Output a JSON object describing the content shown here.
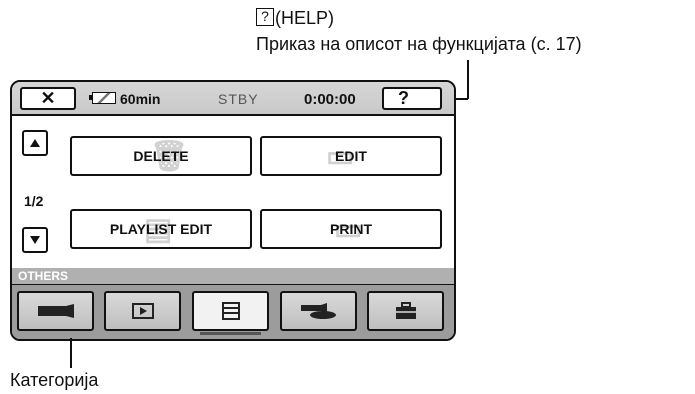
{
  "annotation": {
    "help_key": "?",
    "help_label": "(HELP)",
    "help_description": "Приказ на описот на функцијата (с. 17)",
    "category_label": "Категорија"
  },
  "status_bar": {
    "close_label": "✕",
    "battery_text": "60min",
    "mode": "STBY",
    "time": "0:00:00",
    "help_button": "?"
  },
  "menu": {
    "page_indicator": "1/2",
    "buttons": [
      {
        "label": "DELETE"
      },
      {
        "label": "EDIT"
      },
      {
        "label": "PLAYLIST EDIT"
      },
      {
        "label": "PRINT"
      }
    ]
  },
  "section_label": "OTHERS",
  "tabs": [
    {
      "icon": "camera-icon"
    },
    {
      "icon": "playback-icon"
    },
    {
      "icon": "others-icon",
      "active": true
    },
    {
      "icon": "disc-manage-icon"
    },
    {
      "icon": "toolbox-icon"
    }
  ]
}
